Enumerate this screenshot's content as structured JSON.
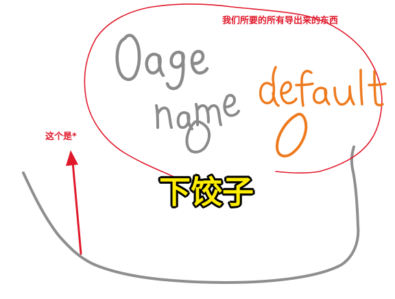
{
  "annotations": {
    "exports_note": "我们所要的所有导出来的东西",
    "this_is_note": "这个是*",
    "big_label": "下饺子"
  },
  "handwriting": {
    "age": "0age",
    "name": "name",
    "name_index": "0",
    "default": "default",
    "default_index": "0"
  },
  "colors": {
    "annotation_red": "#e0192a",
    "handwriting_gray": "#8a8a8a",
    "handwriting_orange": "#ee7a1e",
    "label_yellow": "#ffee00",
    "label_outline": "#000000"
  }
}
